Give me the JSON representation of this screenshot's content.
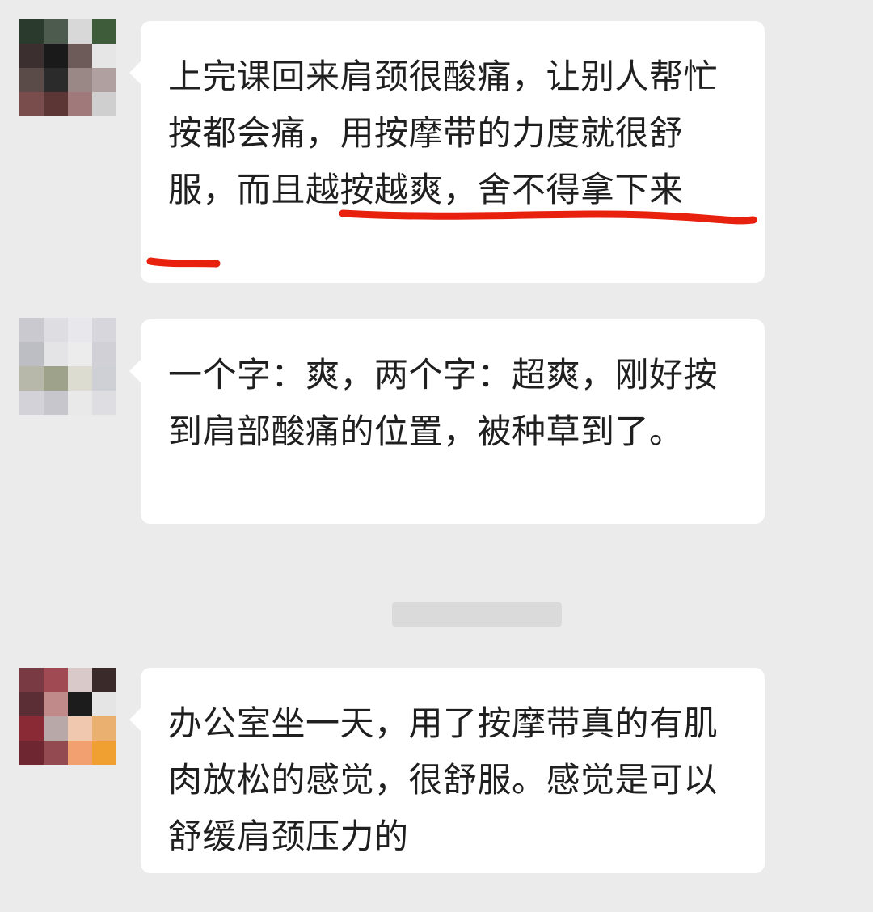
{
  "messages": [
    {
      "text": "上完课回来肩颈很酸痛，让别人帮忙按都会痛，用按摩带的力度就很舒服，而且越按越爽，舍不得拿下来",
      "avatar_palette": [
        "#2a3a2c",
        "#4d5a4e",
        "#d8d8d8",
        "#3e5b3a",
        "#3b2f2f",
        "#1a1a1a",
        "#6c5b58",
        "#e6e6e6",
        "#5a4a48",
        "#2b2b2b",
        "#9a8886",
        "#b0a0a0",
        "#7a4d4d",
        "#5c3535",
        "#a07a7a",
        "#cfcfcf"
      ]
    },
    {
      "text": "一个字：爽，两个字：超爽，刚好按到肩部酸痛的位置，被种草到了。",
      "avatar_palette": [
        "#c9c9cf",
        "#dedee2",
        "#e8e8ec",
        "#d6d6dc",
        "#bdbdc4",
        "#e4e4e6",
        "#ececec",
        "#d0d0d6",
        "#b7b8a9",
        "#9fa28a",
        "#dcdcd0",
        "#cfcfd6",
        "#d2d2d8",
        "#c6c6cc",
        "#e9e9ea",
        "#dedee2"
      ]
    },
    {
      "text": "办公室坐一天，用了按摩带真的有肌肉放松的感觉，很舒服。感觉是可以舒缓肩颈压力的",
      "avatar_palette": [
        "#7a3a44",
        "#a04a54",
        "#d9c9c9",
        "#3a2a2a",
        "#5a2e34",
        "#c08a8a",
        "#1c1c1c",
        "#e5e5e5",
        "#8a2a34",
        "#b8a8a8",
        "#f0c8b0",
        "#e9b070",
        "#6e2630",
        "#934a50",
        "#f2a070",
        "#f0a030"
      ]
    }
  ],
  "highlight_color": "#e8200e"
}
